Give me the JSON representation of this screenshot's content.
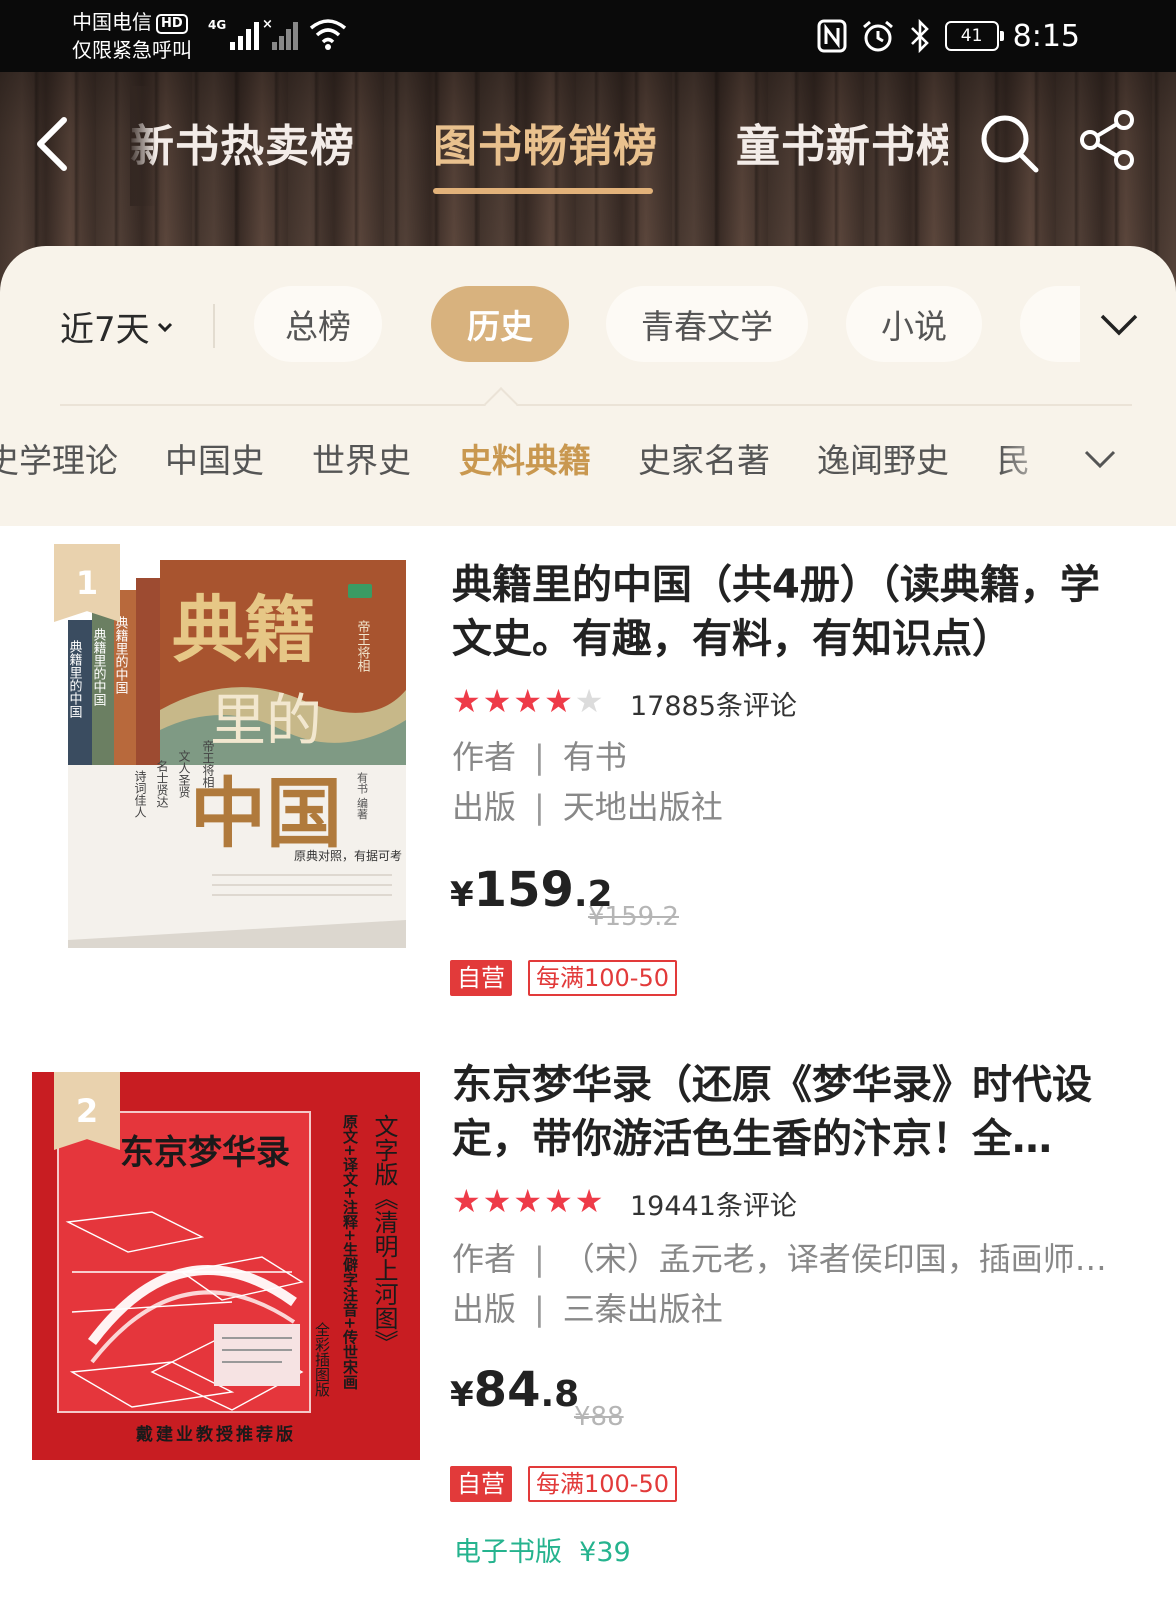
{
  "status_bar": {
    "carrier": "中国电信",
    "hd_label": "HD",
    "carrier_note": "仅限紧急呼叫",
    "network_type": "4G",
    "battery": "41",
    "time": "8:15"
  },
  "nav": {
    "tabs": [
      {
        "label": "新书热卖榜",
        "active": false
      },
      {
        "label": "图书畅销榜",
        "active": true
      },
      {
        "label": "童书新书榜",
        "active": false
      }
    ]
  },
  "filter": {
    "period": "近7天",
    "categories": [
      {
        "label": "总榜",
        "active": false
      },
      {
        "label": "历史",
        "active": true
      },
      {
        "label": "青春文学",
        "active": false
      },
      {
        "label": "小说",
        "active": false
      }
    ],
    "subcategories": [
      {
        "label": "史学理论",
        "active": false
      },
      {
        "label": "中国史",
        "active": false
      },
      {
        "label": "世界史",
        "active": false
      },
      {
        "label": "史料典籍",
        "active": true
      },
      {
        "label": "史家名著",
        "active": false
      },
      {
        "label": "逸闻野史",
        "active": false
      },
      {
        "label": "民",
        "active": false
      }
    ]
  },
  "colors": {
    "accent_gold": "#d8b27e",
    "active_subtab": "#c99850",
    "price_tag_red": "#e23a3a",
    "ebook_green": "#25b38e",
    "star_red": "#ee3b48"
  },
  "products": [
    {
      "rank": "1",
      "title": "典籍里的中国（共4册）（读典籍，学文史。有趣，有料，有知识点）",
      "rating": 4,
      "reviews": "17885条评论",
      "author_label": "作者",
      "author": "有书",
      "publisher_label": "出版",
      "publisher": "天地出版社",
      "price_symbol": "¥",
      "price_int": "159",
      "price_dec": ".2",
      "original_price": "¥159.2",
      "tag_self": "自营",
      "tag_promo": "每满100-50",
      "cover": {
        "title_big_1": "典籍",
        "title_big_2": "里的",
        "title_big_3": "中国",
        "spine_1": "典籍里的中国",
        "spine_2": "典籍里的中国",
        "spine_3": "典籍里的中国",
        "vol_1": "帝王将相",
        "vol_2": "文人圣贤",
        "vol_3": "名士贤达",
        "vol_4": "诗词佳人",
        "editor": "有书 编著",
        "slogan": "原典对照，有据可考"
      }
    },
    {
      "rank": "2",
      "title": "东京梦华录（还原《梦华录》时代设定，带你游活色生香的汴京！全…",
      "rating": 5,
      "reviews": "19441条评论",
      "author_label": "作者",
      "author": "（宋）孟元老，译者侯印国，插画师…",
      "publisher_label": "出版",
      "publisher": "三秦出版社",
      "price_symbol": "¥",
      "price_int": "84",
      "price_dec": ".8",
      "original_price": "¥88",
      "tag_self": "自营",
      "tag_promo": "每满100-50",
      "ebook_label": "电子书版",
      "ebook_price": "¥39",
      "cover": {
        "title": "东京梦华录",
        "side_1": "文字版《清明上河图》",
        "side_2": "原文+译文+注释+生僻字注音+传世宋画",
        "side_3": "全彩插图版",
        "footer": "戴建业教授推荐版"
      }
    }
  ]
}
